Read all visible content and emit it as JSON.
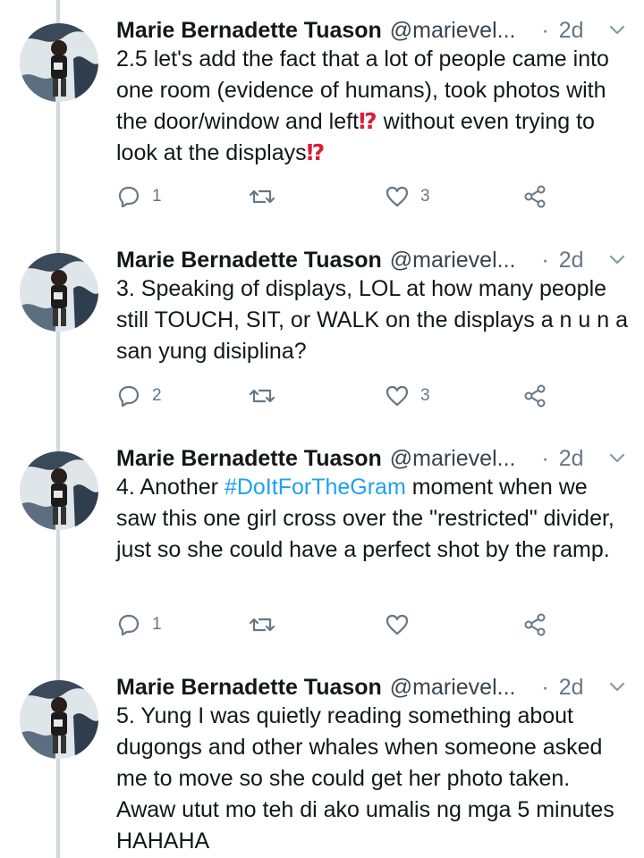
{
  "tweets": [
    {
      "name": "Marie Bernadette Tuason",
      "handle": "@marievel...",
      "separator": "·",
      "time": "2d",
      "text_parts": [
        "2.5 let's add the fact that a lot of people came into one room (evidence of humans), took photos with the door/window and left",
        "⁉",
        " without even trying to look at the displays",
        "⁉"
      ],
      "replies": "1",
      "retweets": "",
      "likes": "3"
    },
    {
      "name": "Marie Bernadette Tuason",
      "handle": "@marievel...",
      "separator": "·",
      "time": "2d",
      "text": "3. Speaking of displays, LOL at how many people still TOUCH, SIT, or WALK on the displays a n u n a san yung disiplina?",
      "replies": "2",
      "retweets": "",
      "likes": "3"
    },
    {
      "name": "Marie Bernadette Tuason",
      "handle": "@marievel...",
      "separator": "·",
      "time": "2d",
      "text_before": "4. Another ",
      "hashtag": "#DoItForTheGram",
      "text_after": " moment when we saw this one girl cross over the \"restricted\" divider, just so she could have a perfect shot by the ramp.",
      "replies": "1",
      "retweets": "",
      "likes": ""
    },
    {
      "name": "Marie Bernadette Tuason",
      "handle": "@marievel...",
      "separator": "·",
      "time": "2d",
      "text": "5. Yung I was quietly reading something about dugongs and other whales when someone asked me to move so she could get her photo taken. Awaw utut mo teh di ako umalis ng mga 5 minutes HAHAHA"
    }
  ],
  "icons": {
    "reply": "reply-icon",
    "retweet": "retweet-icon",
    "like": "heart-icon",
    "share": "share-icon",
    "menu": "chevron-down-icon"
  },
  "colors": {
    "hashtag": "#1da1f2",
    "text": "#14171a",
    "muted": "#657786",
    "emoji_red": "#d6203a"
  }
}
